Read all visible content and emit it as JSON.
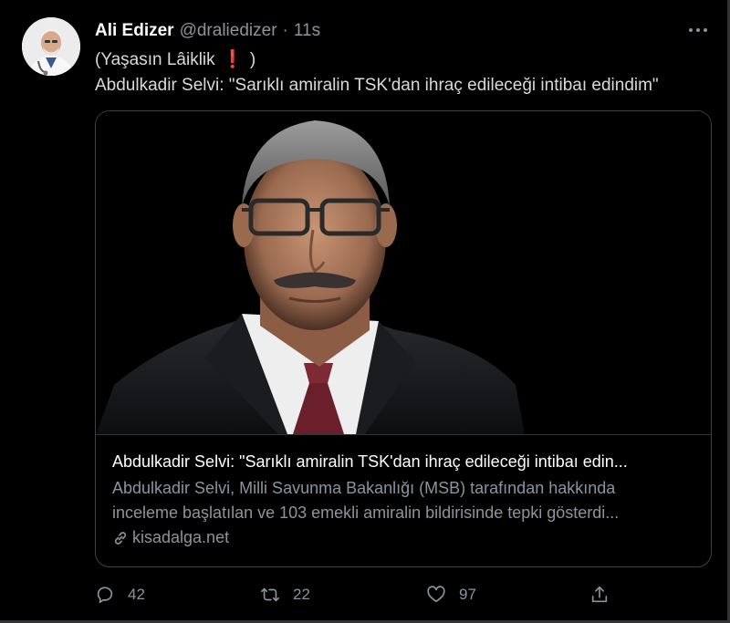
{
  "tweet": {
    "author_name": "Ali Edizer",
    "handle": "@draliedizer",
    "separator": "·",
    "time": "11s",
    "text_line1_before": "(Yaşasın Lâiklik",
    "text_line1_emoji": "❗",
    "text_line1_after": ")",
    "text_line2": "Abdulkadir Selvi: \"Sarıklı amiralin TSK'dan ihraç edileceği intibaı edindim\""
  },
  "card": {
    "title": "Abdulkadir Selvi: \"Sarıklı amiralin TSK'dan ihraç edileceği intibaı edin...",
    "description_line1": "Abdulkadir Selvi, Milli Savunma Bakanlığı (MSB) tarafından hakkında",
    "description_line2": "inceleme başlatılan ve 103 emekli amiralin bildirisinde tepki gösterdi...",
    "domain": "kisadalga.net"
  },
  "actions": {
    "reply_count": "42",
    "retweet_count": "22",
    "like_count": "97"
  },
  "icons": [
    "more-icon",
    "link-icon",
    "reply-icon",
    "retweet-icon",
    "like-icon",
    "share-icon"
  ],
  "colors": {
    "background": "#000000",
    "text": "#d9d9d9",
    "secondary": "#8b949e",
    "emoji_red": "#e0245e",
    "border": "#3d4145"
  }
}
